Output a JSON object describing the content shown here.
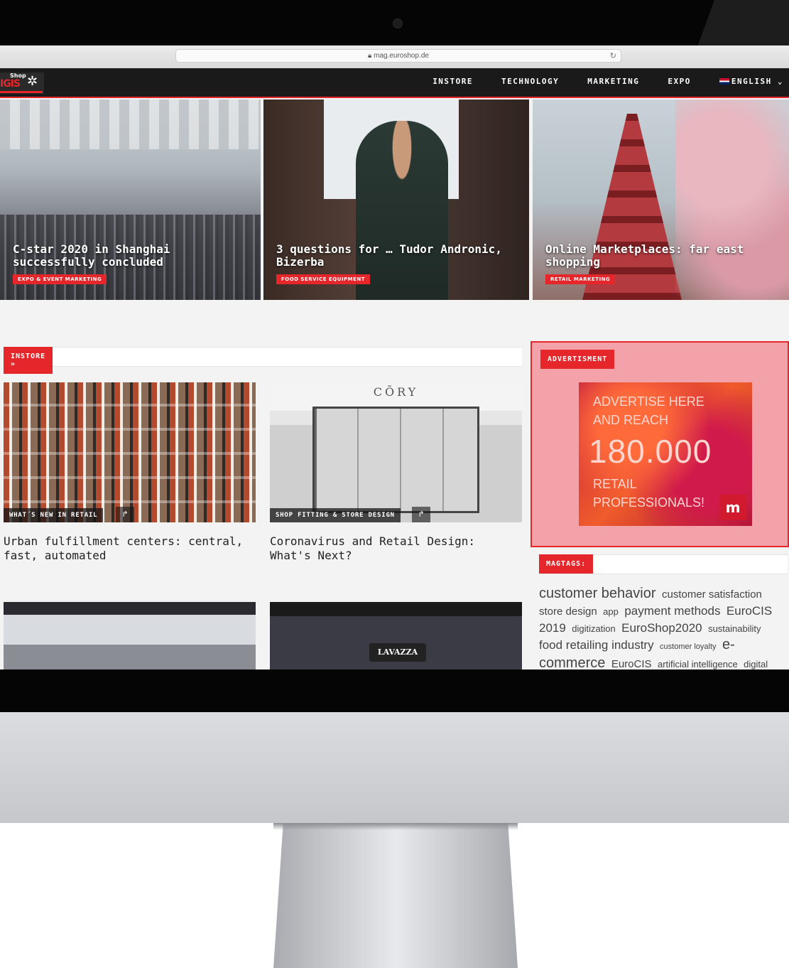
{
  "browser": {
    "url": "mag.euroshop.de"
  },
  "nav": {
    "logo_top": "Shop",
    "logo_main": "IGIS",
    "items": [
      "INSTORE",
      "TECHNOLOGY",
      "MARKETING",
      "EXPO"
    ],
    "language": "ENGLISH",
    "language_chevron": "⌄"
  },
  "hero": [
    {
      "title": "C-star 2020 in Shanghai successfully concluded",
      "tag": "EXPO & EVENT MARKETING"
    },
    {
      "title": "3 questions for … Tudor Andronic, Bizerba",
      "tag": "FOOD SERVICE EQUIPMENT"
    },
    {
      "title": "Online Marketplaces: far east shopping",
      "tag": "RETAIL MARKETING"
    }
  ],
  "instore": {
    "label": "INSTORE »",
    "articles": [
      {
        "category": "WHAT´S NEW IN RETAIL",
        "title": "Urban fulfillment centers: central, fast, automated"
      },
      {
        "category": "SHOP FITTING & STORE DESIGN",
        "title": "Coronavirus and Retail Design: What's Next?",
        "image_text": "CŌRY"
      }
    ],
    "lower_image_text": "LAVAZZA"
  },
  "ad": {
    "label": "ADVERTISMENT",
    "line1": "ADVERTISE HERE",
    "line2": "AND REACH",
    "number": "180.000",
    "line3": "RETAIL",
    "line4": "PROFESSIONALS!",
    "logo": "m"
  },
  "magtags": {
    "label": "MAGTAGS:",
    "tags": [
      {
        "text": "customer behavior",
        "size": "xl"
      },
      {
        "text": "customer satisfaction",
        "size": "m"
      },
      {
        "text": "store design",
        "size": "m"
      },
      {
        "text": "app",
        "size": "s"
      },
      {
        "text": "payment methods",
        "size": "l"
      },
      {
        "text": "EuroCIS 2019",
        "size": "l"
      },
      {
        "text": "digitization",
        "size": "s"
      },
      {
        "text": "EuroShop2020",
        "size": "l"
      },
      {
        "text": "sustainability",
        "size": "s"
      },
      {
        "text": "food retailing industry",
        "size": "l"
      },
      {
        "text": "customer loyalty",
        "size": "xs"
      },
      {
        "text": "e-commerce",
        "size": "xl"
      },
      {
        "text": "EuroCIS",
        "size": "m"
      },
      {
        "text": "artificial intelligence",
        "size": "s"
      },
      {
        "text": "digital",
        "size": "s"
      }
    ]
  },
  "colors": {
    "accent": "#e5262b",
    "nav_bg": "#1a1a1a",
    "ad_bg": "#f3a2a9"
  }
}
